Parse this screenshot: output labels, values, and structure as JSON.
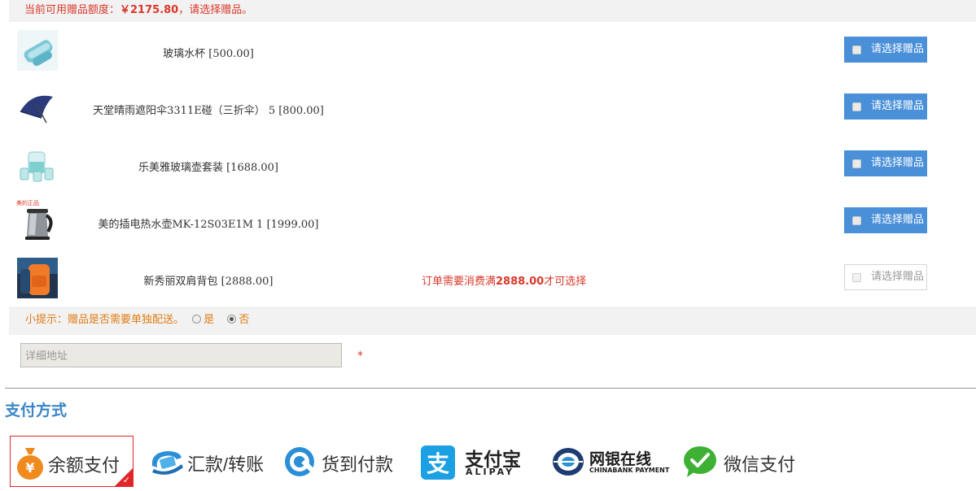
{
  "quota": {
    "prefix": "当前可用赠品额度：",
    "amount": "￥2175.80",
    "suffix": "，请选择赠品。"
  },
  "gifts": [
    {
      "name": "玻璃水杯 [500.00]",
      "button": "请选择赠品",
      "note_pre": "",
      "note_amt": "",
      "note_post": ""
    },
    {
      "name": "天堂晴雨遮阳伞3311E碰（三折伞） 5 [800.00]",
      "button": "请选择赠品",
      "note_pre": "",
      "note_amt": "",
      "note_post": ""
    },
    {
      "name": "乐美雅玻璃壶套装 [1688.00]",
      "button": "请选择赠品",
      "note_pre": "",
      "note_amt": "",
      "note_post": ""
    },
    {
      "name": "美的插电热水壶MK-12S03E1M 1 [1999.00]",
      "button": "请选择赠品",
      "note_pre": "",
      "note_amt": "",
      "note_post": "",
      "thumb_tag": "美的正品"
    },
    {
      "name": "新秀丽双肩背包 [2888.00]",
      "button": "请选择赠品",
      "note_pre": "订单需要消费满",
      "note_amt": "2888.00",
      "note_post": "才可选择"
    }
  ],
  "tip": {
    "text": "小提示：赠品是否需要单独配送。",
    "options": [
      "是",
      "否"
    ],
    "selected": "否"
  },
  "address": {
    "placeholder": "详细地址",
    "required_mark": "*"
  },
  "payment": {
    "title": "支付方式",
    "options": [
      {
        "label": "余额支付",
        "icon": "money-bag-icon",
        "selected": true
      },
      {
        "label": "汇款/转账",
        "icon": "transfer-icon",
        "selected": false
      },
      {
        "label": "货到付款",
        "icon": "cod-icon",
        "selected": false
      },
      {
        "label": "支付宝",
        "sub": "ALIPAY",
        "icon": "alipay-icon",
        "selected": false
      },
      {
        "label": "网银在线",
        "sub": "CHINABANK PAYMENT",
        "icon": "chinabank-icon",
        "selected": false
      },
      {
        "label": "微信支付",
        "icon": "wechat-icon",
        "selected": false
      }
    ]
  },
  "colors": {
    "accent_blue": "#4a90d9",
    "alert_red": "#d9382b",
    "tip_orange": "#e07c16",
    "alipay_blue": "#1aa0e3",
    "wechat_green": "#3eb135",
    "money_orange": "#f08a1f"
  }
}
